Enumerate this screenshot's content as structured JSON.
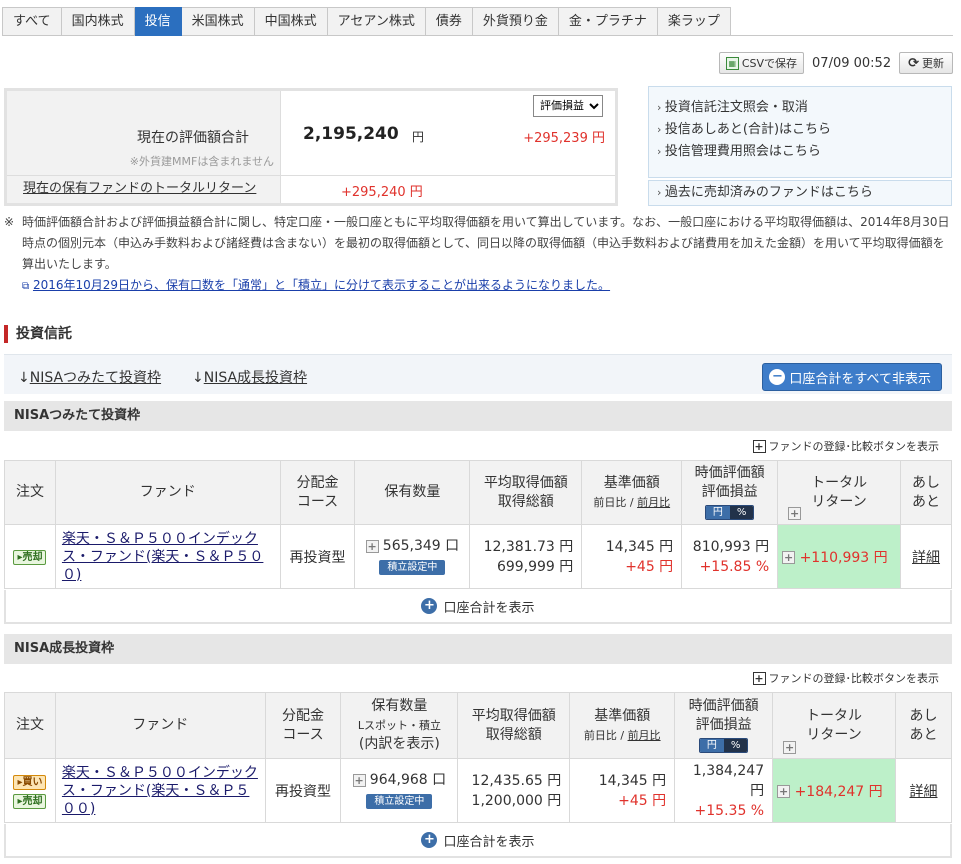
{
  "tabs": [
    "すべて",
    "国内株式",
    "投信",
    "米国株式",
    "中国株式",
    "アセアン株式",
    "債券",
    "外貨預り金",
    "金・プラチナ",
    "楽ラップ"
  ],
  "toolbar": {
    "csv_label": "CSVで保存",
    "datetime": "07/09 00:52",
    "refresh_label": "更新"
  },
  "summary": {
    "label": "現在の評価額合計",
    "amount": "2,195,240",
    "yen": "円",
    "gain": "+295,239 円",
    "note": "※外貨建MMFは含まれません",
    "select_value": "評価損益",
    "total_return_label": "現在の保有ファンドのトータルリターン",
    "total_return_value": "+295,240 円"
  },
  "links": [
    "投資信託注文照会・取消",
    "投信あしあと(合計)はこちら",
    "投信管理費用照会はこちら"
  ],
  "link_past": "過去に売却済みのファンドはこちら",
  "disclaimer": {
    "mark": "※",
    "text": "時価評価額合計および評価損益額合計に関し、特定口座・一般口座ともに平均取得価額を用いて算出しています。なお、一般口座における平均取得価額は、2014年8月30日時点の個別元本（申込み手数料および諸経費は含まない）を最初の取得価額として、同日以降の取得価額（申込手数料および諸費用を加えた金額）を用いて平均取得価額を算出いたします。",
    "link": "2016年10月29日から、保有口数を「通常」と「積立」に分けて表示することが出来るようになりました。"
  },
  "section_title": "投資信託",
  "anchors": {
    "a1": "NISAつみたて投資枠",
    "a2": "NISA成長投資枠",
    "hide_all": "口座合計をすべて非表示"
  },
  "register_label": "ファンドの登録･比較ボタンを表示",
  "show_total_label": "口座合計を表示",
  "headers": {
    "order": "注文",
    "fund": "ファンド",
    "dist1": "分配金",
    "dist2": "コース",
    "qty": "保有数量",
    "qty_sub": "Lスポット・積立",
    "qty_detail": "(内訳を表示)",
    "avg1": "平均取得価額",
    "avg2": "取得総額",
    "base1": "基準価額",
    "base2": "前日比",
    "base_sep": "/",
    "base3": "前月比",
    "val1": "時価評価額",
    "val2": "評価損益",
    "pm_yen": "円",
    "pm_pct": "%",
    "tr1": "トータル",
    "tr2": "リターン",
    "ashi1": "あし",
    "ashi2": "あと"
  },
  "nisa_tsumitate": {
    "title": "NISAつみたて投資枠",
    "order_sell": "売却",
    "fund": "楽天・Ｓ＆Ｐ５００インデックス・ファンド(楽天・Ｓ＆Ｐ５００)",
    "course": "再投資型",
    "qty": "565,349 口",
    "tsumitate": "積立設定中",
    "avg_price": "12,381.73 円",
    "total_cost": "699,999 円",
    "base_price": "14,345 円",
    "day_change": "+45 円",
    "market_value": "810,993 円",
    "gain_pct": "+15.85 %",
    "total_return": "+110,993 円",
    "detail": "詳細"
  },
  "nisa_growth": {
    "title": "NISA成長投資枠",
    "order_buy": "買い",
    "order_sell": "売却",
    "fund": "楽天・Ｓ＆Ｐ５００インデックス・ファンド(楽天・Ｓ＆Ｐ５００)",
    "course": "再投資型",
    "qty": "964,968 口",
    "tsumitate": "積立設定中",
    "avg_price": "12,435.65 円",
    "total_cost": "1,200,000 円",
    "base_price": "14,345 円",
    "day_change": "+45 円",
    "market_value": "1,384,247 円",
    "gain_pct": "+15.35 %",
    "total_return": "+184,247 円",
    "detail": "詳細"
  }
}
